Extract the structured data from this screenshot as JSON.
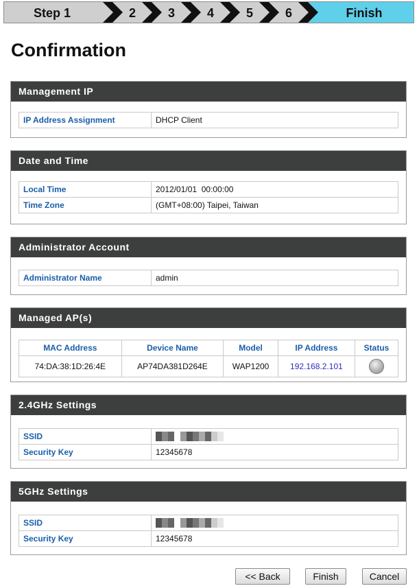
{
  "wizard": {
    "steps": [
      "Step 1",
      "2",
      "3",
      "4",
      "5",
      "6"
    ],
    "finish_label": "Finish"
  },
  "page": {
    "title": "Confirmation"
  },
  "management_ip": {
    "heading": "Management IP",
    "rows": [
      {
        "label": "IP Address Assignment",
        "value": "DHCP Client"
      }
    ]
  },
  "date_time": {
    "heading": "Date and Time",
    "rows": [
      {
        "label": "Local Time",
        "value": "2012/01/01  00:00:00"
      },
      {
        "label": "Time Zone",
        "value": "(GMT+08:00) Taipei, Taiwan"
      }
    ]
  },
  "admin": {
    "heading": "Administrator Account",
    "rows": [
      {
        "label": "Administrator Name",
        "value": "admin"
      }
    ]
  },
  "managed_ap": {
    "heading": "Managed AP(s)",
    "columns": [
      "MAC Address",
      "Device Name",
      "Model",
      "IP Address",
      "Status"
    ],
    "rows": [
      {
        "mac": "74:DA:38:1D:26:4E",
        "device": "AP74DA381D264E",
        "model": "WAP1200",
        "ip": "192.168.2.101",
        "status_icon": "status-gray-orb-icon"
      }
    ]
  },
  "wifi_24": {
    "heading": "2.4GHz Settings",
    "ssid_label": "SSID",
    "key_label": "Security Key",
    "key_value": "12345678"
  },
  "wifi_5": {
    "heading": "5GHz Settings",
    "ssid_label": "SSID",
    "key_label": "Security Key",
    "key_value": "12345678"
  },
  "buttons": {
    "back": "<< Back",
    "finish": "Finish",
    "cancel": "Cancel"
  },
  "colors": {
    "header_bg": "#3d3f3f",
    "label_blue": "#1a5ea8",
    "finish_step": "#5fd0ea",
    "link_ip": "#2a2ac8"
  }
}
